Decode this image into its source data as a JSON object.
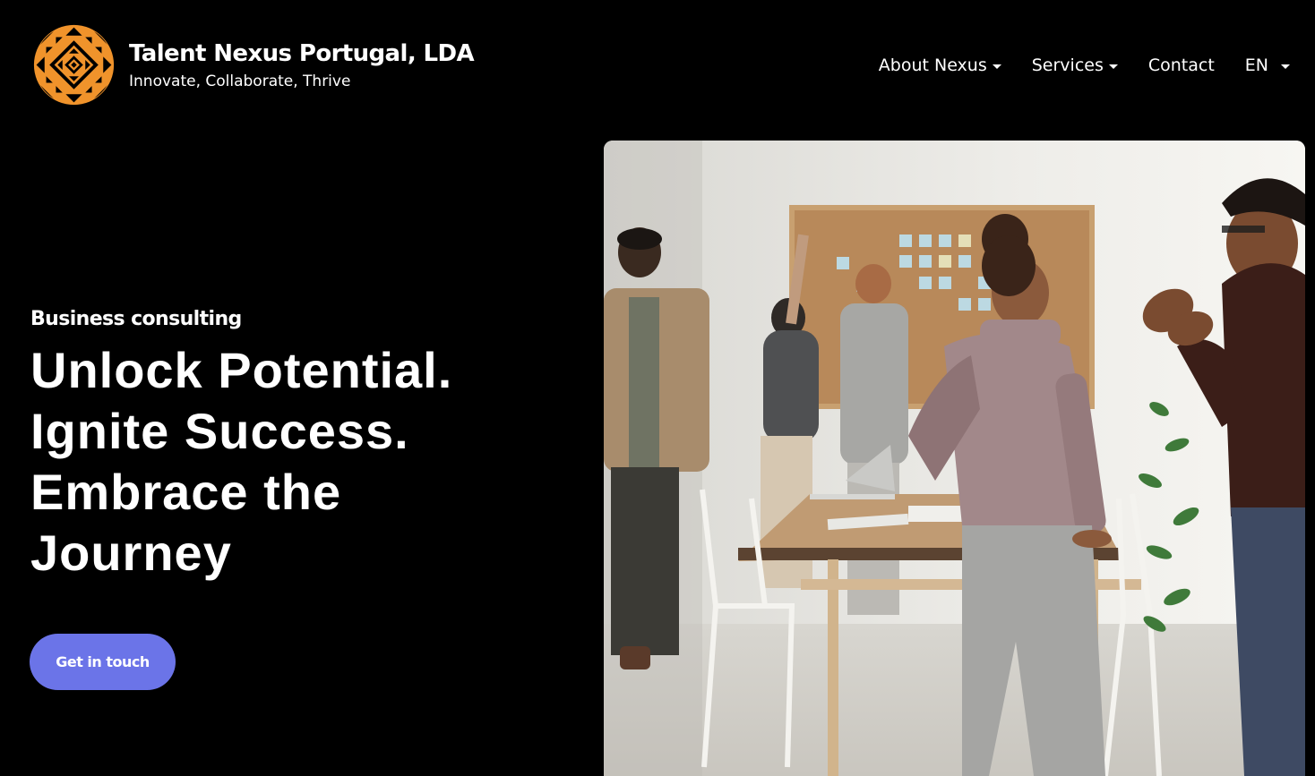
{
  "brand": {
    "name": "Talent Nexus Portugal, LDA",
    "tagline": "Innovate, Collaborate, Thrive",
    "logo_icon": "geometric-diamond-logo-icon",
    "logo_color": "#f0932b"
  },
  "nav": {
    "items": [
      {
        "label": "About Nexus",
        "has_dropdown": true
      },
      {
        "label": "Services",
        "has_dropdown": true
      },
      {
        "label": "Contact",
        "has_dropdown": false
      }
    ],
    "language": "EN"
  },
  "hero": {
    "kicker": "Business consulting",
    "title_lines": [
      "Unlock Potential.",
      "Ignite Success.",
      "Embrace the",
      "Journey"
    ],
    "cta_label": "Get in touch",
    "cta_color": "#6b74e8",
    "image_subject": "team-meeting-office-photo"
  },
  "colors": {
    "background": "#000000",
    "text": "#ffffff",
    "accent": "#6b74e8",
    "logo_orange": "#f0932b"
  }
}
